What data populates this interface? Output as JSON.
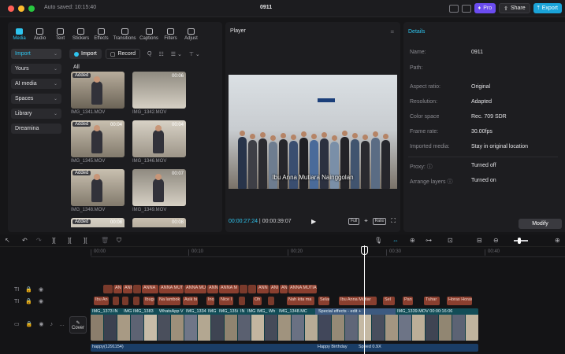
{
  "titlebar": {
    "autosave": "Auto saved: 10:15:40",
    "project_title": "0911",
    "pro_label": "Pro",
    "share_label": "Share",
    "export_label": "Export"
  },
  "window_controls": {
    "close_color": "#ff5f57",
    "minimize_color": "#febc2e",
    "zoom_color": "#28c840"
  },
  "toolbar": {
    "items": [
      "Media",
      "Audio",
      "Text",
      "Stickers",
      "Effects",
      "Transitions",
      "Captions",
      "Filters",
      "Adjust"
    ]
  },
  "sidemenu": {
    "items": [
      {
        "label": "Import",
        "chevron": "⌄"
      },
      {
        "label": "Yours",
        "chevron": "⌄"
      },
      {
        "label": "AI media",
        "chevron": "⌄"
      },
      {
        "label": "Spaces",
        "chevron": "⌄"
      },
      {
        "label": "Library",
        "chevron": "⌄"
      },
      {
        "label": "Dreamina",
        "chevron": ""
      }
    ]
  },
  "media": {
    "import_label": "Import",
    "record_label": "Record",
    "tool_labels": [
      "Q",
      "☷",
      "☰ ⌄",
      "⊤ ⌄"
    ],
    "filter_all": "All",
    "thumbs": [
      {
        "name": "IMG_1341.MOV",
        "badge": "Added",
        "duration": ""
      },
      {
        "name": "IMG_1342.MOV",
        "badge": "",
        "duration": "00:06"
      },
      {
        "name": "IMG_1345.MOV",
        "badge": "Added",
        "duration": "00:04"
      },
      {
        "name": "IMG_1346.MOV",
        "badge": "",
        "duration": "00:04"
      },
      {
        "name": "IMG_1348.MOV",
        "badge": "Added",
        "duration": ""
      },
      {
        "name": "IMG_1349.MOV",
        "badge": "",
        "duration": "00:07"
      },
      {
        "name": "",
        "badge": "Added",
        "duration": "00:08"
      },
      {
        "name": "",
        "badge": "",
        "duration": "00:08"
      }
    ]
  },
  "player": {
    "title": "Player",
    "subtitle": "Ibu Anna Mutiara Nainggolan",
    "current_time": "00:00:27:24",
    "total_time": "00:00:39:07",
    "controls": [
      "Full",
      "⌖",
      "Ratio",
      "⛶"
    ]
  },
  "details": {
    "title": "Details",
    "rows": [
      {
        "label": "Name:",
        "value": "0911"
      },
      {
        "label": "Path:",
        "value": ""
      },
      {
        "label": "Aspect ratio:",
        "value": "Original"
      },
      {
        "label": "Resolution:",
        "value": "Adapted"
      },
      {
        "label": "Color space",
        "value": "Rec. 709 SDR"
      },
      {
        "label": "Frame rate:",
        "value": "30.00fps"
      },
      {
        "label": "Imported media:",
        "value": "Stay in original location"
      },
      {
        "label": "Proxy: ⓘ",
        "value": "Turned off"
      },
      {
        "label": "Arrange layers ⓘ",
        "value": "Turned on"
      }
    ],
    "modify_label": "Modify"
  },
  "timeline": {
    "ruler": [
      "00:00",
      "00:10",
      "00:20",
      "00:30",
      "00:40"
    ],
    "cover_label": "Cover",
    "text_track_1": [
      "AN",
      "ANI",
      "ANNA",
      "ANNA MUT",
      "ANNA MU",
      "ANN",
      "ANNA M",
      "ANN",
      "ANI",
      "AN",
      "ANNA MUTIA"
    ],
    "text_track_2": [
      "Ibu An",
      "Ibuga",
      "Na lambok",
      "Asik bi",
      "Inoj",
      "Nice I",
      "Oh",
      "Nah kita ma",
      "Selam",
      "Ibu Anna Mutiar",
      "Sel",
      "Pan",
      "Tuhar",
      "Horas Horas"
    ],
    "video_labels": [
      "IMG_1373",
      "IN",
      "IMG",
      "IMG_1383",
      "WhatsApp V",
      "IMG_1334",
      "IMG",
      "IMG_135i",
      "IN",
      "IMG",
      "IMG_",
      "Wh",
      "IMG_1348.MC",
      "Special effects - edit +",
      "IMG_1339.MOV  00:00:16:06"
    ],
    "audio_labels": [
      "happy(1291154)",
      "Happy Birthday",
      "Speed 0.9X"
    ]
  }
}
